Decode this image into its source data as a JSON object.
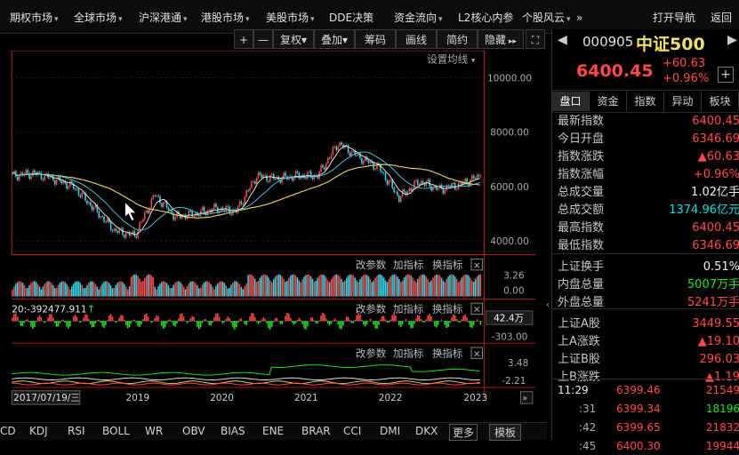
{
  "nav": {
    "tabs": [
      {
        "label": "期权市场",
        "dd": true
      },
      {
        "label": "全球市场",
        "dd": true
      },
      {
        "label": "沪深港通",
        "dd": true
      },
      {
        "label": "港股市场",
        "dd": true
      },
      {
        "label": "美股市场",
        "dd": true
      },
      {
        "label": "DDE决策",
        "dd": false
      },
      {
        "label": "资金流向",
        "dd": true
      },
      {
        "label": "L2核心内参",
        "dd": false
      },
      {
        "label": "个股风云",
        "dd": true
      }
    ],
    "more": "»",
    "open_nav": "打开导航",
    "back": "返回"
  },
  "toolbar": {
    "plus": "+",
    "minus": "—",
    "fuquan": "复权",
    "diejia": "叠加",
    "chouma": "筹码",
    "huaxian": "画线",
    "jianyue": "简约",
    "yincang": "隐藏"
  },
  "chart": {
    "ma_setting": "设置均线",
    "y_labels": [
      "10000.00",
      "8000.00",
      "6000.00",
      "4000.00"
    ],
    "vol_labels": [
      "3.26",
      "0.00"
    ],
    "ind1_label": "20:-392477.911",
    "ind1_badge": "42.4万",
    "ind1_neg": "-303.00",
    "ind2_labels": [
      "3.48",
      "-2.21"
    ],
    "x_labels": [
      "2019",
      "2020",
      "2021",
      "2022",
      "2023"
    ],
    "date_label": "2017/07/19/三",
    "panel_buttons": [
      "改参数",
      "加指标",
      "换指标"
    ],
    "close": "×"
  },
  "chart_data": {
    "type": "line",
    "ylim": [
      3500,
      11000
    ],
    "x": [
      "2017/07",
      "2017/10",
      "2018/01",
      "2018/04",
      "2018/07",
      "2018/10",
      "2019/01",
      "2019/04",
      "2019/07",
      "2019/10",
      "2020/01",
      "2020/04",
      "2020/07",
      "2020/10",
      "2021/01",
      "2021/04",
      "2021/07",
      "2021/10",
      "2022/01",
      "2022/04",
      "2022/07",
      "2022/10",
      "2023/01",
      "2023/03"
    ],
    "series": [
      {
        "values": [
          6400,
          6500,
          6300,
          6000,
          5200,
          4400,
          4200,
          5700,
          4900,
          5000,
          5200,
          5100,
          6400,
          6300,
          6400,
          6400,
          7600,
          7100,
          6700,
          5600,
          6200,
          5900,
          6100,
          6400
        ]
      }
    ]
  },
  "right_panel": {
    "code": "000905",
    "name": "中证500",
    "price": "6400.45",
    "change": "+60.63",
    "change_pct": "+0.96%",
    "tabs": [
      "盘口",
      "资金",
      "指数",
      "异动",
      "板块"
    ],
    "rows": [
      {
        "k": "最新指数",
        "v": "6400.45",
        "c": "red"
      },
      {
        "k": "今日开盘",
        "v": "6346.69",
        "c": "red"
      },
      {
        "k": "指数涨跌",
        "v": "▲60.63",
        "c": "red"
      },
      {
        "k": "指数涨幅",
        "v": "+0.96%",
        "c": "red"
      },
      {
        "k": "总成交量",
        "v": "1.02亿手",
        "c": "white"
      },
      {
        "k": "总成交额",
        "v": "1374.96亿元",
        "c": "cyan"
      },
      {
        "k": "最高指数",
        "v": "6400.45",
        "c": "red"
      },
      {
        "k": "最低指数",
        "v": "6346.69",
        "c": "red"
      },
      {
        "k": "上证换手",
        "v": "0.51%",
        "c": "white"
      },
      {
        "k": "内盘总量",
        "v": "5007万手",
        "c": "green"
      },
      {
        "k": "外盘总量",
        "v": "5241万手",
        "c": "red"
      },
      {
        "k": "上证A股",
        "v": "3449.55",
        "c": "red"
      },
      {
        "k": "上A涨跌",
        "v": "▲19.10",
        "c": "red"
      },
      {
        "k": "上证B股",
        "v": "296.03",
        "c": "red"
      },
      {
        "k": "上B涨跌",
        "v": "▲1.19",
        "c": "red"
      }
    ],
    "ticks": [
      {
        "t": "11:29",
        "p": "6399.46",
        "v": "21549",
        "vc": "red"
      },
      {
        "t": ":31",
        "p": "6399.34",
        "v": "18196",
        "vc": "green"
      },
      {
        "t": ":42",
        "p": "6399.65",
        "v": "21832",
        "vc": "red"
      },
      {
        "t": ":45",
        "p": "6400.30",
        "v": "19944",
        "vc": "red"
      }
    ]
  },
  "bottom": {
    "items": [
      "CD",
      "KDJ",
      "RSI",
      "BOLL",
      "WR",
      "OBV",
      "BIAS",
      "ENE",
      "BRAR",
      "CCI",
      "DMI",
      "DKX"
    ],
    "more": "更多",
    "template": "模板"
  }
}
